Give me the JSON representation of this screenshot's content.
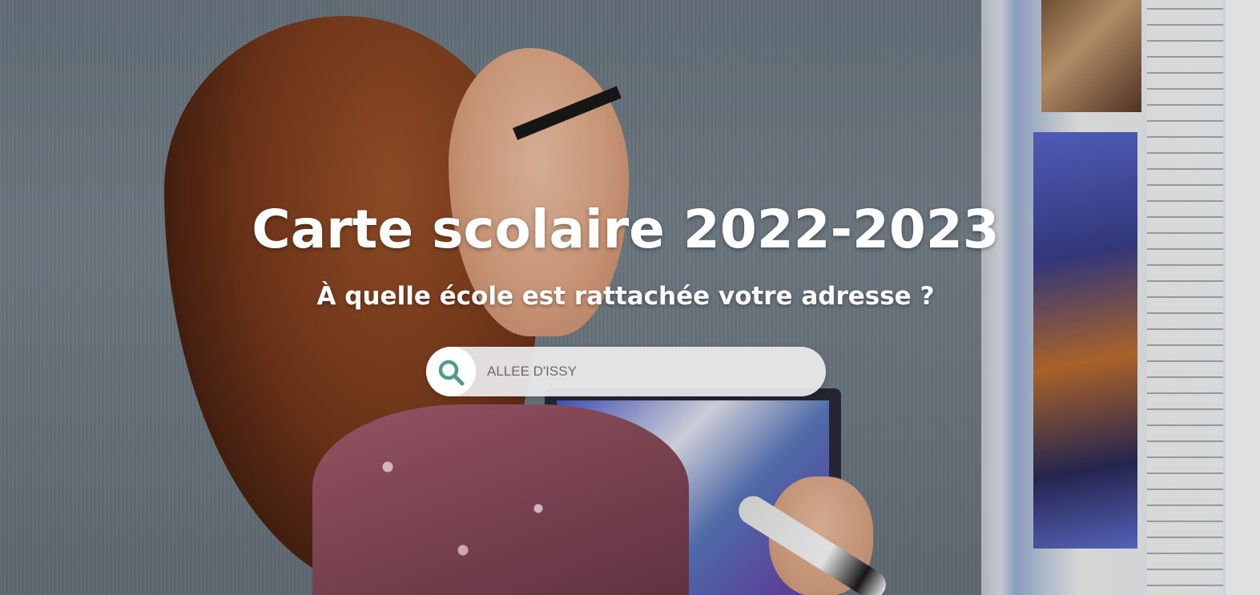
{
  "hero": {
    "title": "Carte scolaire 2022-2023",
    "subtitle": "À quelle école est rattachée votre adresse ?"
  },
  "search": {
    "placeholder": "ALLEE D'ISSY",
    "value": "",
    "icon": "search-icon",
    "icon_color": "#4f9b87"
  }
}
